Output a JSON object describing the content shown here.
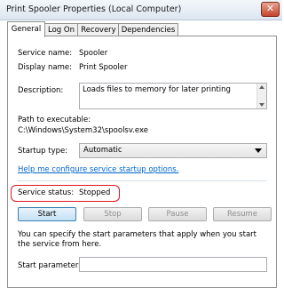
{
  "window": {
    "title": "Print Spooler Properties (Local Computer)",
    "close_glyph": "✕"
  },
  "tabs": [
    {
      "label": "General",
      "active": true
    },
    {
      "label": "Log On",
      "active": false
    },
    {
      "label": "Recovery",
      "active": false
    },
    {
      "label": "Dependencies",
      "active": false
    }
  ],
  "general": {
    "service_name_label": "Service name:",
    "service_name_value": "Spooler",
    "display_name_label": "Display name:",
    "display_name_value": "Print Spooler",
    "description_label": "Description:",
    "description_value": "Loads files to memory for later printing",
    "path_label": "Path to executable:",
    "path_value": "C:\\Windows\\System32\\spoolsv.exe",
    "startup_type_label": "Startup type:",
    "startup_type_value": "Automatic",
    "help_link": "Help me configure service startup options.",
    "service_status_label": "Service status:",
    "service_status_value": "Stopped",
    "buttons": {
      "start": "Start",
      "stop": "Stop",
      "pause": "Pause",
      "resume": "Resume"
    },
    "params_help": "You can specify the start parameters that apply when you start the service from here.",
    "start_params_label": "Start parameters:",
    "start_params_value": ""
  },
  "colors": {
    "highlight": "#e0141f",
    "link": "#0066cc"
  }
}
